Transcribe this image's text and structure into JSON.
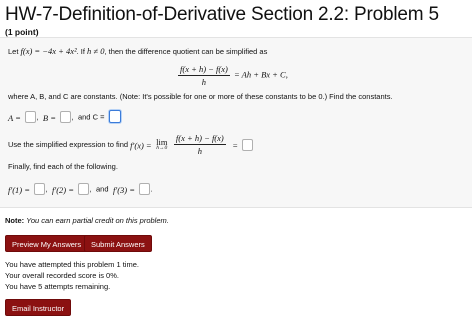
{
  "title": "HW-7-Definition-of-Derivative Section 2.2: Problem 5",
  "points": "(1 point)",
  "problem": {
    "let_prefix": "Let ",
    "f_def": "f(x) = −4x + 4x²",
    "if_text": ". If ",
    "h_cond": "h ≠ 0",
    "intro_suffix": ", then the difference quotient can be simplified as",
    "dq_numerator": "f(x + h) − f(x)",
    "dq_denominator": "h",
    "dq_result": "= Ah + Bx + C,",
    "where_text": "where A, B, and C are constants. (Note: It's possible for one or more of these constants to be 0.) Find the constants.",
    "a_label": "A =",
    "b_label": "B =",
    "and_c_text": "and C =",
    "derivative_prompt": "Use the simplified expression to find ",
    "fprime_x": "f′(x) =",
    "lim_text": "lim",
    "lim_sub": "h→0",
    "equals": "=",
    "finally_text": "Finally, find each of the following.",
    "fp1_label": "f′(1) =",
    "fp2_label": "f′(2) =",
    "and_text": "and",
    "fp3_label": "f′(3) ="
  },
  "note": {
    "label": "Note:",
    "text": "You can earn partial credit on this problem."
  },
  "buttons": {
    "preview": "Preview My Answers",
    "submit": "Submit Answers",
    "email": "Email Instructor"
  },
  "status": {
    "attempted": "You have attempted this problem 1 time.",
    "score": "Your overall recorded score is 0%.",
    "remaining": "You have 5 attempts remaining."
  },
  "colors": {
    "button": "#8b1111",
    "focus": "#3b7bd9",
    "panel": "#f7f7f7"
  }
}
